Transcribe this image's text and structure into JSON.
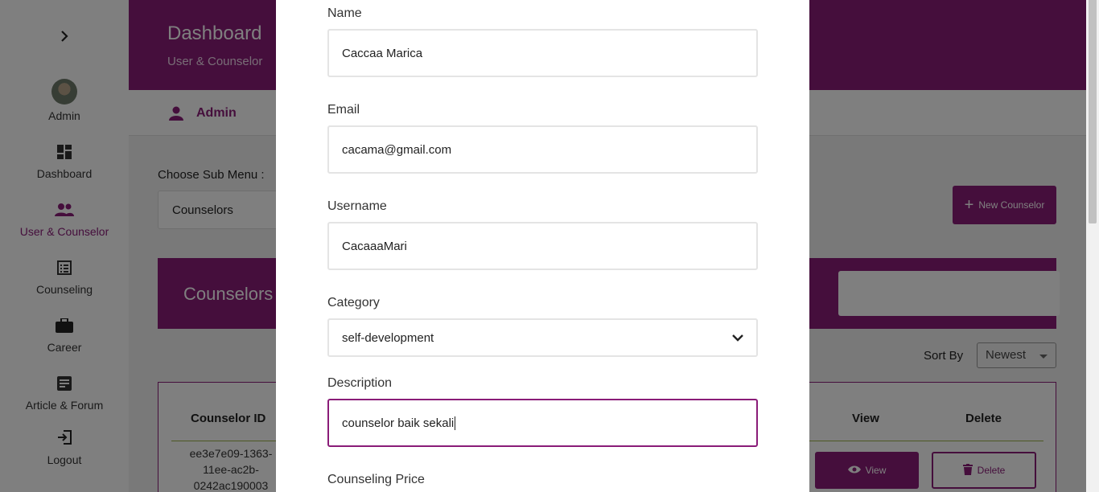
{
  "sidebar": {
    "toggle_icon": "chevron-right-icon",
    "items": [
      {
        "label": "Admin",
        "icon": "avatar"
      },
      {
        "label": "Dashboard",
        "icon": "dashboard-icon"
      },
      {
        "label": "User & Counselor",
        "icon": "users-icon",
        "active": true
      },
      {
        "label": "Counseling",
        "icon": "list-icon"
      },
      {
        "label": "Career",
        "icon": "briefcase-icon"
      },
      {
        "label": "Article & Forum",
        "icon": "article-icon"
      },
      {
        "label": "Logout",
        "icon": "logout-icon"
      }
    ]
  },
  "header": {
    "title": "Dashboard",
    "subtitle": "User & Counselor"
  },
  "admin_bar": {
    "label": "Admin",
    "icon": "user-icon"
  },
  "submenu": {
    "label": "Choose Sub Menu :",
    "value": "Counselors"
  },
  "new_button": {
    "label": "New Counselor",
    "icon": "plus-icon"
  },
  "counselors_band": {
    "title": "Counselors"
  },
  "sort": {
    "label": "Sort By",
    "value": "Newest"
  },
  "table": {
    "columns": [
      "Counselor ID",
      "View",
      "Delete"
    ],
    "rows": [
      {
        "id": "ee3e7e09-1363-11ee-ac2b-0242ac190003",
        "id_lines": [
          "ee3e7e09-1363-",
          "11ee-ac2b-",
          "0242ac190003"
        ],
        "view_label": "View",
        "delete_label": "Delete"
      }
    ]
  },
  "modal": {
    "name": {
      "label": "Name",
      "value": "Caccaa Marica"
    },
    "email": {
      "label": "Email",
      "value": "cacama@gmail.com"
    },
    "username": {
      "label": "Username",
      "value": "CacaaaMari"
    },
    "category": {
      "label": "Category",
      "value": "self-development"
    },
    "description": {
      "label": "Description",
      "value": "counselor baik sekali"
    },
    "price": {
      "label": "Counseling Price"
    }
  },
  "colors": {
    "brand": "#8a1c78",
    "brand_dark": "#4a1e3f",
    "overlay": "rgba(0,0,0,0.5)"
  }
}
